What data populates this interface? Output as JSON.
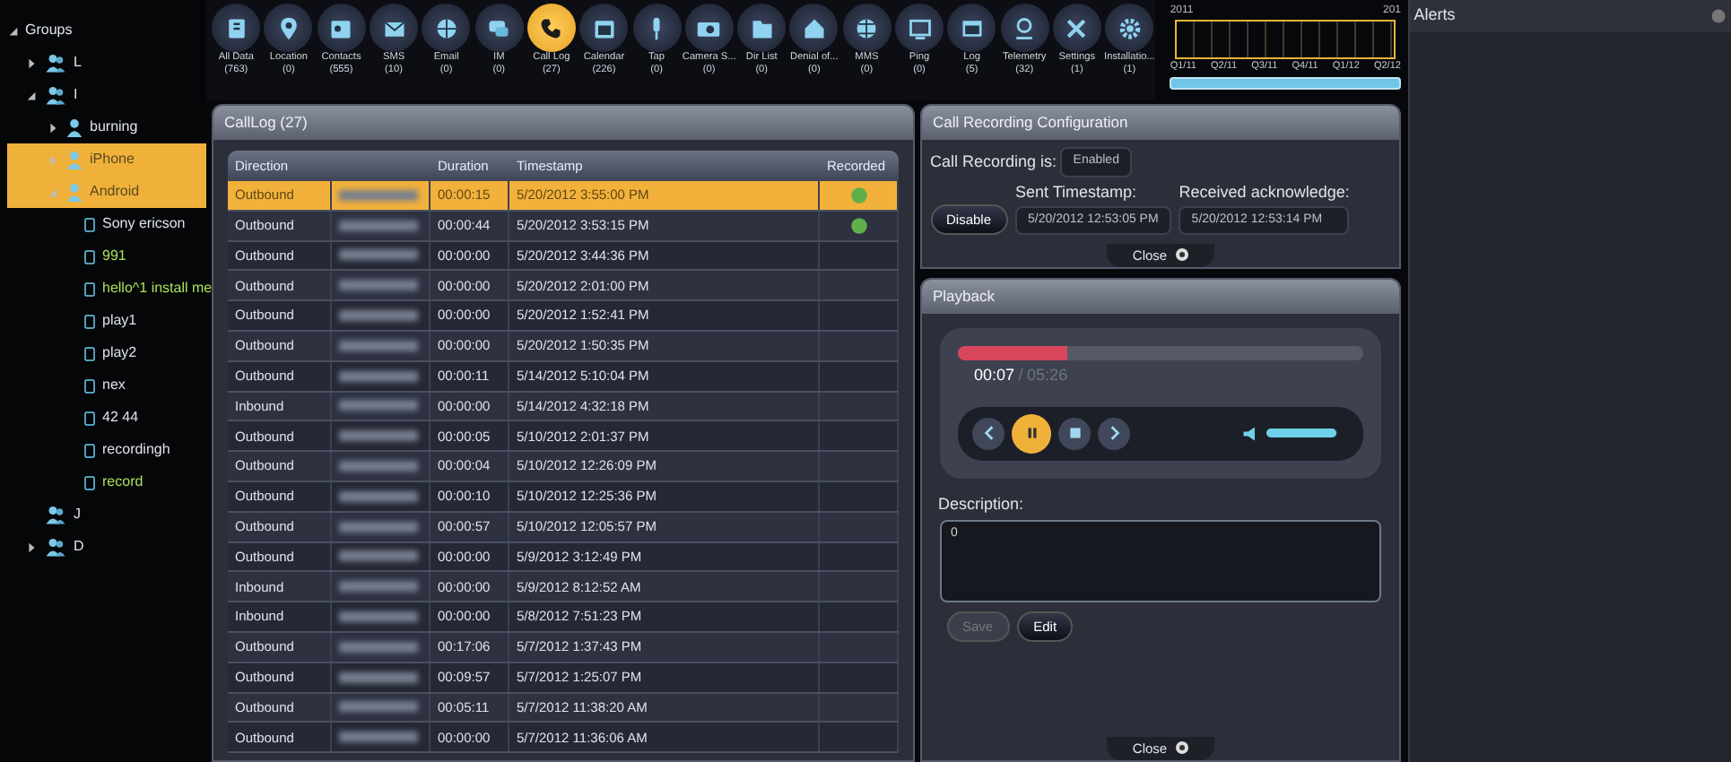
{
  "sidebar": {
    "title": "Groups",
    "expanded": true,
    "items": [
      {
        "label": "L",
        "kind": "group",
        "expanded": false,
        "selected": false
      },
      {
        "label": "I",
        "kind": "group",
        "expanded": true,
        "selected": false,
        "children": [
          {
            "label": "burning",
            "kind": "person",
            "expanded": false,
            "selected": false
          },
          {
            "label": "iPhone",
            "kind": "person",
            "expanded": false,
            "selected": true
          },
          {
            "label": "Android",
            "kind": "person",
            "expanded": true,
            "selected": true,
            "children": [
              {
                "label": "Sony ericson",
                "kind": "device",
                "active": false
              },
              {
                "label": "991",
                "kind": "device",
                "active": true
              },
              {
                "label": "hello^1 install me",
                "kind": "device",
                "active": true
              },
              {
                "label": "play1",
                "kind": "device",
                "active": false
              },
              {
                "label": "play2",
                "kind": "device",
                "active": false
              },
              {
                "label": "nex",
                "kind": "device",
                "active": false
              },
              {
                "label": "42 44",
                "kind": "device",
                "active": false
              },
              {
                "label": "recordingh",
                "kind": "device",
                "active": false
              },
              {
                "label": "record",
                "kind": "device",
                "active": true
              }
            ]
          }
        ]
      },
      {
        "label": "J",
        "kind": "group",
        "selected": false
      },
      {
        "label": "D",
        "kind": "group",
        "expanded": false,
        "selected": false
      }
    ]
  },
  "toolbar": [
    {
      "label": "All Data",
      "count": "(763)",
      "selected": false
    },
    {
      "label": "Location",
      "count": "(0)",
      "selected": false
    },
    {
      "label": "Contacts",
      "count": "(555)",
      "selected": false
    },
    {
      "label": "SMS",
      "count": "(10)",
      "selected": false
    },
    {
      "label": "Email",
      "count": "(0)",
      "selected": false
    },
    {
      "label": "IM",
      "count": "(0)",
      "selected": false
    },
    {
      "label": "Call Log",
      "count": "(27)",
      "selected": true
    },
    {
      "label": "Calendar",
      "count": "(226)",
      "selected": false
    },
    {
      "label": "Tap",
      "count": "(0)",
      "selected": false
    },
    {
      "label": "Camera S...",
      "count": "(0)",
      "selected": false
    },
    {
      "label": "Dir List",
      "count": "(0)",
      "selected": false
    },
    {
      "label": "Denial of...",
      "count": "(0)",
      "selected": false
    },
    {
      "label": "MMS",
      "count": "(0)",
      "selected": false
    },
    {
      "label": "Ping",
      "count": "(0)",
      "selected": false
    },
    {
      "label": "Log",
      "count": "(5)",
      "selected": false
    },
    {
      "label": "Telemetry",
      "count": "(32)",
      "selected": false
    },
    {
      "label": "Settings",
      "count": "(1)",
      "selected": false
    },
    {
      "label": "Installatio...",
      "count": "(1)",
      "selected": false
    }
  ],
  "timeline": {
    "years": [
      "2011",
      "201"
    ],
    "quarters": [
      "Q1/11",
      "Q2/11",
      "Q3/11",
      "Q4/11",
      "Q1/12",
      "Q2/12"
    ]
  },
  "call_log": {
    "title": "CallLog (27)",
    "columns": [
      "Direction",
      "Duration",
      "Timestamp",
      "Recorded"
    ],
    "rows": [
      {
        "direction": "Outbound",
        "duration": "00:00:15",
        "timestamp": "5/20/2012 3:55:00 PM",
        "recorded": true,
        "selected": true
      },
      {
        "direction": "Outbound",
        "duration": "00:00:44",
        "timestamp": "5/20/2012 3:53:15 PM",
        "recorded": true,
        "selected": false
      },
      {
        "direction": "Outbound",
        "duration": "00:00:00",
        "timestamp": "5/20/2012 3:44:36 PM",
        "recorded": false,
        "selected": false
      },
      {
        "direction": "Outbound",
        "duration": "00:00:00",
        "timestamp": "5/20/2012 2:01:00 PM",
        "recorded": false,
        "selected": false
      },
      {
        "direction": "Outbound",
        "duration": "00:00:00",
        "timestamp": "5/20/2012 1:52:41 PM",
        "recorded": false,
        "selected": false
      },
      {
        "direction": "Outbound",
        "duration": "00:00:00",
        "timestamp": "5/20/2012 1:50:35 PM",
        "recorded": false,
        "selected": false
      },
      {
        "direction": "Outbound",
        "duration": "00:00:11",
        "timestamp": "5/14/2012 5:10:04 PM",
        "recorded": false,
        "selected": false
      },
      {
        "direction": "Inbound",
        "duration": "00:00:00",
        "timestamp": "5/14/2012 4:32:18 PM",
        "recorded": false,
        "selected": false
      },
      {
        "direction": "Outbound",
        "duration": "00:00:05",
        "timestamp": "5/10/2012 2:01:37 PM",
        "recorded": false,
        "selected": false
      },
      {
        "direction": "Outbound",
        "duration": "00:00:04",
        "timestamp": "5/10/2012 12:26:09 PM",
        "recorded": false,
        "selected": false
      },
      {
        "direction": "Outbound",
        "duration": "00:00:10",
        "timestamp": "5/10/2012 12:25:36 PM",
        "recorded": false,
        "selected": false
      },
      {
        "direction": "Outbound",
        "duration": "00:00:57",
        "timestamp": "5/10/2012 12:05:57 PM",
        "recorded": false,
        "selected": false
      },
      {
        "direction": "Outbound",
        "duration": "00:00:00",
        "timestamp": "5/9/2012 3:12:49 PM",
        "recorded": false,
        "selected": false
      },
      {
        "direction": "Inbound",
        "duration": "00:00:00",
        "timestamp": "5/9/2012 8:12:52 AM",
        "recorded": false,
        "selected": false
      },
      {
        "direction": "Inbound",
        "duration": "00:00:00",
        "timestamp": "5/8/2012 7:51:23 PM",
        "recorded": false,
        "selected": false
      },
      {
        "direction": "Outbound",
        "duration": "00:17:06",
        "timestamp": "5/7/2012 1:37:43 PM",
        "recorded": false,
        "selected": false
      },
      {
        "direction": "Outbound",
        "duration": "00:09:57",
        "timestamp": "5/7/2012 1:25:07 PM",
        "recorded": false,
        "selected": false
      },
      {
        "direction": "Outbound",
        "duration": "00:05:11",
        "timestamp": "5/7/2012 11:38:20 AM",
        "recorded": false,
        "selected": false
      },
      {
        "direction": "Outbound",
        "duration": "00:00:00",
        "timestamp": "5/7/2012 11:36:06 AM",
        "recorded": false,
        "selected": false
      }
    ]
  },
  "recording_config": {
    "title": "Call Recording Configuration",
    "status_label": "Call Recording is:",
    "status_value": "Enabled",
    "disable_button": "Disable",
    "sent_label": "Sent Timestamp:",
    "sent_value": "5/20/2012 12:53:05 PM",
    "ack_label": "Received acknowledge:",
    "ack_value": "5/20/2012 12:53:14 PM",
    "close": "Close"
  },
  "playback": {
    "title": "Playback",
    "progress": {
      "level": 0.27
    },
    "elapsed": "00:07",
    "separator": "/",
    "total": "05:26",
    "playing": true,
    "volume": {
      "level": 0.97
    },
    "description_label": "Description:",
    "description_value": "0",
    "save_button": {
      "label": "Save",
      "disabled": true
    },
    "edit_button": {
      "label": "Edit",
      "disabled": false
    },
    "close": "Close"
  },
  "alerts": {
    "title": "Alerts"
  }
}
